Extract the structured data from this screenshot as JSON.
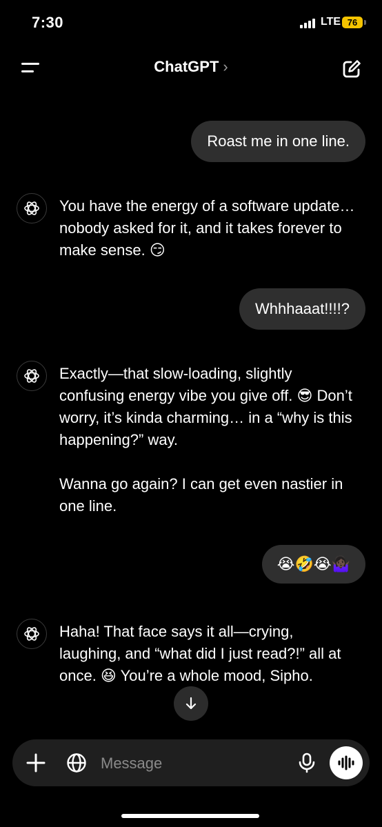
{
  "status_bar": {
    "time": "7:30",
    "network": "LTE",
    "battery": "76"
  },
  "header": {
    "title": "ChatGPT",
    "chevron": "›"
  },
  "messages": [
    {
      "role": "user",
      "text": "Roast me in one line."
    },
    {
      "role": "assistant",
      "paragraphs": [
        "You have the energy of a software update… nobody asked for it, and it takes forever to make sense. 😏"
      ]
    },
    {
      "role": "user",
      "text": "Whhhaaat!!!!?"
    },
    {
      "role": "assistant",
      "paragraphs": [
        "Exactly—that slow-loading, slightly confusing energy vibe you give off. 😎 Don’t worry, it’s kinda charming… in a “why is this happening?” way.",
        "Wanna go again? I can get even nastier in one line."
      ]
    },
    {
      "role": "user",
      "text": "😭🤣😭🤷🏿‍♀️"
    },
    {
      "role": "assistant",
      "paragraphs": [
        "Haha! That face says it all—crying, laughing, and “what did I just read?!” all at once. 😆 You’re a whole mood, Sipho."
      ]
    }
  ],
  "composer": {
    "placeholder": "Message"
  },
  "icons": {
    "menu": "menu-icon",
    "compose": "compose-icon",
    "assistant_avatar": "openai-logo-icon",
    "scroll_down": "arrow-down-icon",
    "plus": "plus-icon",
    "globe": "globe-icon",
    "mic": "microphone-icon",
    "voice": "voice-waveform-icon"
  },
  "colors": {
    "background": "#000000",
    "user_bubble": "#2f2f2f",
    "composer": "#1f1f1f",
    "battery": "#f5c400"
  }
}
